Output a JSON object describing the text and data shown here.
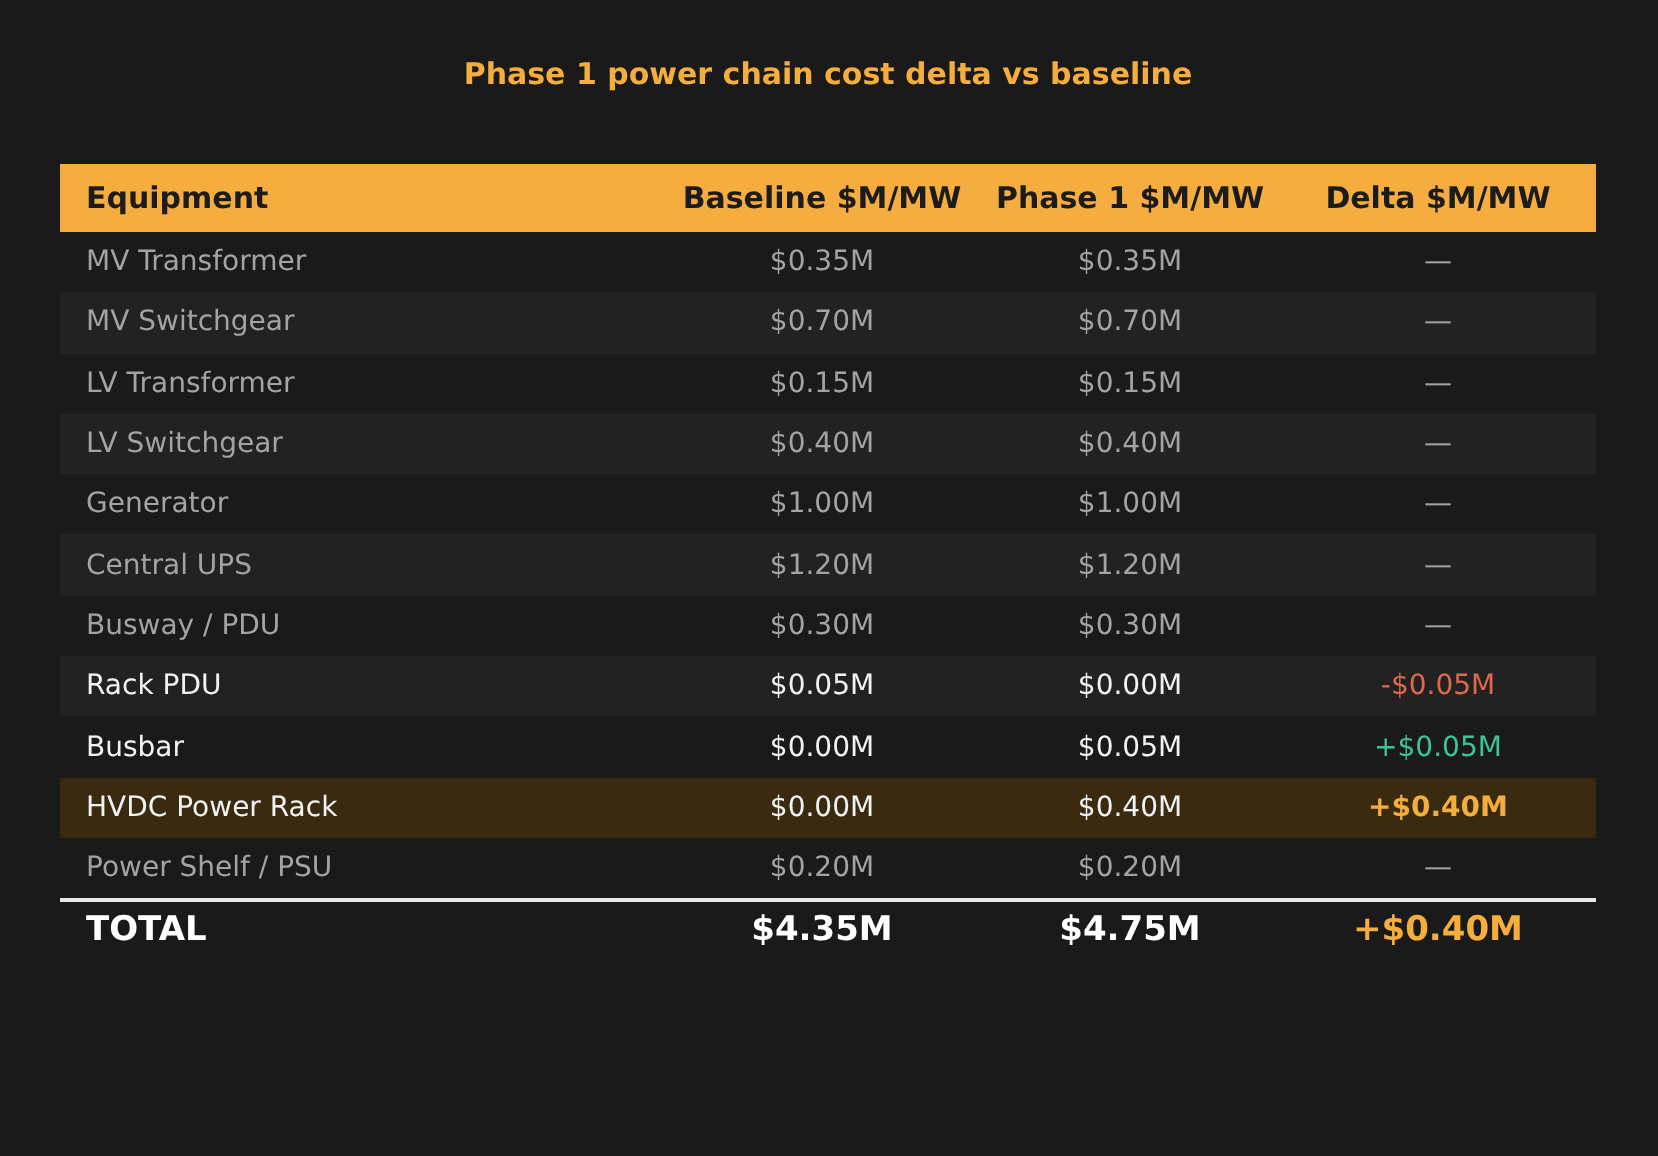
{
  "title": "Phase 1 power chain cost delta vs baseline",
  "table": {
    "columns": [
      "Equipment",
      "Baseline $M/MW",
      "Phase 1 $M/MW",
      "Delta $M/MW"
    ],
    "rows": [
      {
        "kind": "unchanged",
        "cells": [
          "MV Transformer",
          "$0.35M",
          "$0.35M",
          "—"
        ]
      },
      {
        "kind": "unchanged",
        "cells": [
          "MV Switchgear",
          "$0.70M",
          "$0.70M",
          "—"
        ]
      },
      {
        "kind": "unchanged",
        "cells": [
          "LV Transformer",
          "$0.15M",
          "$0.15M",
          "—"
        ]
      },
      {
        "kind": "unchanged",
        "cells": [
          "LV Switchgear",
          "$0.40M",
          "$0.40M",
          "—"
        ]
      },
      {
        "kind": "unchanged",
        "cells": [
          "Generator",
          "$1.00M",
          "$1.00M",
          "—"
        ]
      },
      {
        "kind": "unchanged",
        "cells": [
          "Central UPS",
          "$1.20M",
          "$1.20M",
          "—"
        ]
      },
      {
        "kind": "unchanged",
        "cells": [
          "Busway / PDU",
          "$0.30M",
          "$0.30M",
          "—"
        ]
      },
      {
        "kind": "decrease",
        "cells": [
          "Rack PDU",
          "$0.05M",
          "$0.00M",
          "-$0.05M"
        ]
      },
      {
        "kind": "increase",
        "cells": [
          "Busbar",
          "$0.00M",
          "$0.05M",
          "+$0.05M"
        ]
      },
      {
        "kind": "highlight",
        "cells": [
          "HVDC Power Rack",
          "$0.00M",
          "$0.40M",
          "+$0.40M"
        ]
      },
      {
        "kind": "unchanged",
        "cells": [
          "Power Shelf / PSU",
          "$0.20M",
          "$0.20M",
          "—"
        ]
      }
    ],
    "total": [
      "TOTAL",
      "$4.35M",
      "$4.75M",
      "+$0.40M"
    ]
  }
}
